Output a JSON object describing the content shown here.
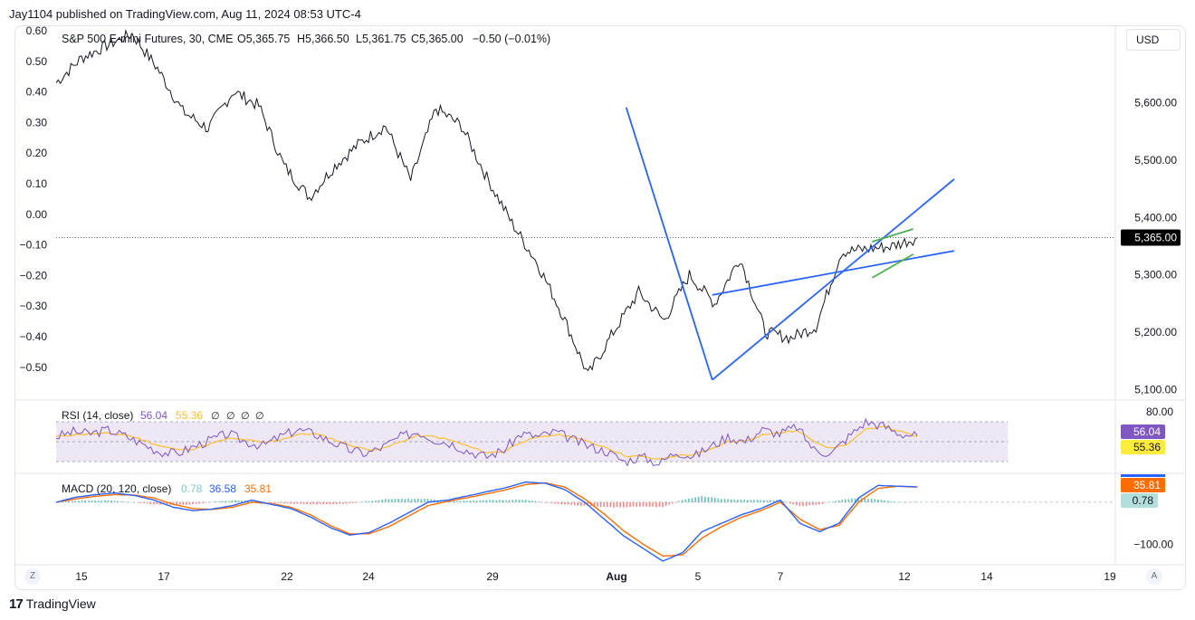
{
  "publisher": "Jay1104 published on TradingView.com, Aug 11, 2024 08:53 UTC-4",
  "footer_brand": "TradingView",
  "currency_label": "USD",
  "corner_left": "Z",
  "corner_right": "A",
  "header": {
    "symbol": "S&P 500 E-mini Futures, 30, CME",
    "open": "O5,365.75",
    "high": "H5,366.50",
    "low": "L5,361.75",
    "close": "C5,365.00",
    "change": "−0.50 (−0.01%)"
  },
  "colors": {
    "price": "#131722",
    "trendline": "#2962ff",
    "flag": "#4caf50",
    "rsi_line": "#7e57c2",
    "rsi_ma": "#fbc02d",
    "rsi_band": "#ede7f6",
    "macd_line": "#2962ff",
    "signal_line": "#ff6d00",
    "hist_pos": "#26a69a",
    "hist_neg": "#ef5350",
    "last_price_bg": "#000000",
    "rsi_badge": "#7e57c2",
    "rsi_ma_badge": "#ffeb3b",
    "macd_badge": "#ff6d00",
    "hist_badge": "#b2dfdb"
  },
  "chart_data": [
    {
      "type": "line",
      "title": "S&P 500 E-mini Futures, 30, CME",
      "x_labels": [
        "15",
        "17",
        "22",
        "24",
        "29",
        "Aug",
        "5",
        "7",
        "12",
        "14",
        "19"
      ],
      "y_right_ticks": [
        "5,700.00",
        "5,600.00",
        "5,500.00",
        "5,400.00",
        "5,300.00",
        "5,200.00",
        "5,100.00"
      ],
      "y_left_ticks": [
        "0.60",
        "0.50",
        "0.40",
        "0.30",
        "0.20",
        "0.10",
        "0.00",
        "−0.10",
        "−0.20",
        "−0.30",
        "−0.40",
        "−0.50"
      ],
      "last_price": "5,365.00",
      "ylim": [
        5085,
        5735
      ],
      "x": [
        "Jul 12",
        "Jul 15",
        "Jul 16",
        "Jul 17",
        "Jul 18",
        "Jul 19",
        "Jul 22",
        "Jul 23",
        "Jul 24",
        "Jul 25",
        "Jul 26",
        "Jul 29",
        "Jul 30",
        "Jul 31",
        "Aug 1",
        "Aug 2",
        "Aug 5",
        "Aug 6",
        "Aug 7",
        "Aug 8",
        "Aug 9"
      ],
      "series": [
        {
          "values": [
            5635,
            5678,
            5700,
            5720,
            5660,
            5585,
            5555,
            5620,
            5595,
            5490,
            5435,
            5490,
            5530,
            5560,
            5465,
            5590,
            5560,
            5470,
            5390,
            5320,
            5230,
            5125,
            5200,
            5270,
            5220,
            5300,
            5250,
            5330,
            5200,
            5190,
            5210,
            5340,
            5345,
            5350,
            5365
          ]
        }
      ],
      "trendlines": [
        {
          "from": [
            "Jul 31 late",
            5592
          ],
          "to": [
            "Aug 5",
            5117
          ]
        },
        {
          "from": [
            "Aug 5",
            5117
          ],
          "to": [
            "Aug 12 late",
            5467
          ]
        },
        {
          "from": [
            "Aug 5",
            5265
          ],
          "to": [
            "Aug 12 late",
            5342
          ]
        },
        {
          "from": [
            "Aug 8 late",
            5358
          ],
          "to": [
            "Aug 9 late",
            5380
          ]
        },
        {
          "from": [
            "Aug 8 late",
            5295
          ],
          "to": [
            "Aug 9 late",
            5336
          ]
        }
      ]
    },
    {
      "type": "line",
      "name": "RSI",
      "label": "RSI (14, close)",
      "value": "56.04",
      "ma_value": "55.36",
      "na_markers": [
        "∅",
        "∅",
        "∅",
        "∅"
      ],
      "y_ticks": [
        "80.00"
      ],
      "ylim": [
        20,
        90
      ],
      "upper": 70,
      "lower": 30,
      "middle": 50,
      "rsi": [
        55,
        60,
        58,
        62,
        56,
        48,
        40,
        38,
        45,
        52,
        58,
        50,
        46,
        55,
        62,
        58,
        50,
        42,
        38,
        45,
        55,
        60,
        52,
        48,
        40,
        35,
        42,
        58,
        55,
        60,
        52,
        45,
        40,
        30,
        35,
        28,
        40,
        35,
        45,
        55,
        50,
        62,
        58,
        65,
        42,
        38,
        55,
        70,
        66,
        58,
        56
      ],
      "rsi_ma": [
        55,
        57,
        58,
        58,
        57,
        52,
        46,
        42,
        43,
        48,
        53,
        52,
        49,
        52,
        57,
        58,
        53,
        47,
        42,
        43,
        50,
        56,
        55,
        51,
        45,
        39,
        40,
        50,
        54,
        57,
        55,
        49,
        44,
        36,
        35,
        32,
        36,
        37,
        42,
        50,
        51,
        57,
        59,
        61,
        51,
        43,
        48,
        62,
        66,
        60,
        55.36
      ]
    },
    {
      "type": "line",
      "name": "MACD",
      "label": "MACD (20, 120, close)",
      "histogram_value": "0.78",
      "macd_value": "36.58",
      "signal_value": "35.81",
      "y_ticks": [
        "−100.00"
      ],
      "ylim": [
        -140,
        60
      ],
      "macd": [
        0,
        12,
        18,
        22,
        16,
        5,
        -12,
        -20,
        -16,
        -8,
        5,
        -5,
        -15,
        -35,
        -60,
        -78,
        -72,
        -50,
        -25,
        0,
        5,
        15,
        25,
        35,
        48,
        45,
        30,
        0,
        -40,
        -80,
        -110,
        -140,
        -120,
        -70,
        -50,
        -30,
        -15,
        5,
        -50,
        -70,
        -50,
        10,
        40,
        38,
        36.58
      ],
      "signal": [
        0,
        8,
        14,
        18,
        17,
        10,
        -5,
        -15,
        -17,
        -12,
        0,
        -3,
        -12,
        -30,
        -55,
        -75,
        -75,
        -58,
        -33,
        -8,
        2,
        11,
        20,
        30,
        42,
        46,
        36,
        8,
        -28,
        -68,
        -100,
        -128,
        -125,
        -85,
        -58,
        -36,
        -20,
        0,
        -40,
        -65,
        -55,
        0,
        33,
        38,
        35.81
      ],
      "histogram": [
        0,
        4,
        4,
        4,
        -1,
        -5,
        -7,
        -5,
        1,
        4,
        5,
        -2,
        -3,
        -5,
        -5,
        -3,
        3,
        8,
        8,
        8,
        3,
        4,
        5,
        5,
        6,
        -1,
        -6,
        -8,
        -12,
        -12,
        -10,
        -12,
        5,
        15,
        8,
        6,
        5,
        5,
        -10,
        -5,
        5,
        10,
        7,
        0,
        0.78
      ]
    }
  ]
}
